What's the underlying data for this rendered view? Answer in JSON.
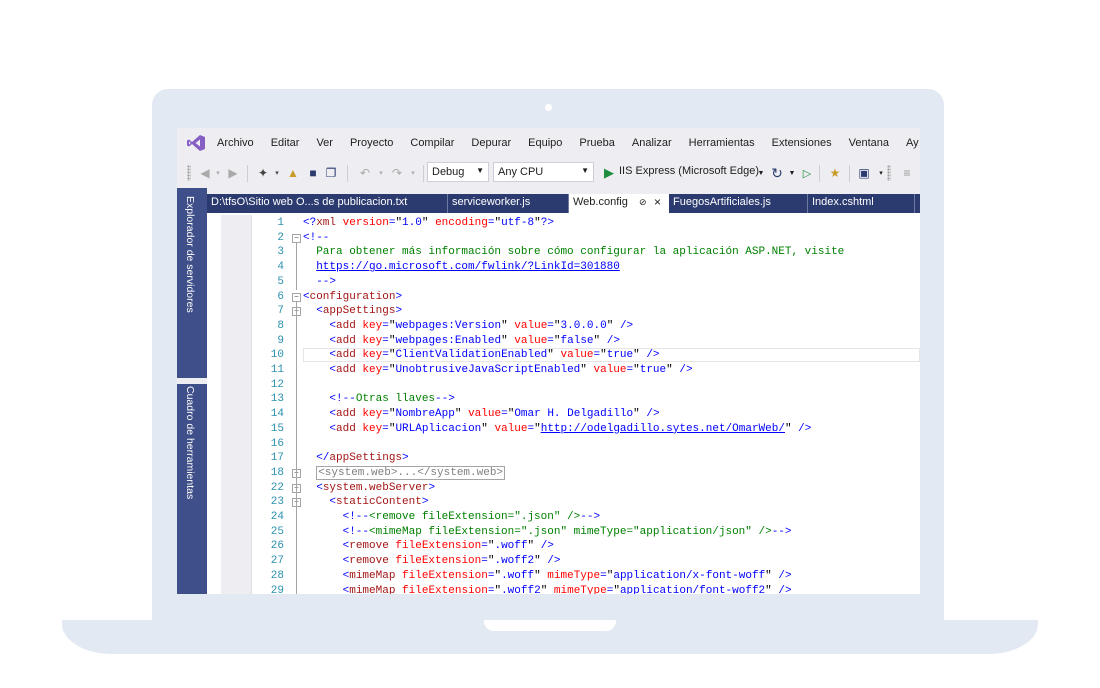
{
  "menu": {
    "items": [
      "Archivo",
      "Editar",
      "Ver",
      "Proyecto",
      "Compilar",
      "Depurar",
      "Equipo",
      "Prueba",
      "Analizar",
      "Herramientas",
      "Extensiones",
      "Ventana",
      "Ay"
    ]
  },
  "toolbar": {
    "config_value": "Debug",
    "platform_value": "Any CPU",
    "run_label": "IIS Express (Microsoft Edge)"
  },
  "rail": {
    "server_explorer": "Explorador de servidores",
    "toolbox": "Cuadro de herramientas"
  },
  "tabs": [
    {
      "label": "D:\\tfsO\\Sitio web O...s de publicacion.txt"
    },
    {
      "label": "serviceworker.js"
    },
    {
      "label": "Web.config"
    },
    {
      "label": "FuegosArtificiales.js"
    },
    {
      "label": "Index.cshtml"
    }
  ],
  "colors": {
    "rail_bg": "#3f4f89",
    "tab_strip": "#2b3b70",
    "vs_purple": "#865fc5",
    "play_green": "#1e8c3c",
    "keyword_blue": "#0000ff",
    "element_maroon": "#a31515",
    "attribute_red": "#ff0000",
    "comment_green": "#008000",
    "line_number": "#2b91af"
  },
  "editor": {
    "lines": [
      {
        "n": "1",
        "fold": "",
        "segs": [
          [
            "t-blue",
            "<?"
          ],
          [
            "t-maroon",
            "xml"
          ],
          [
            "t-red",
            " version"
          ],
          [
            "t-blue",
            "="
          ],
          [
            "t-black",
            "\""
          ],
          [
            "t-blue",
            "1.0"
          ],
          [
            "t-black",
            "\""
          ],
          [
            "t-red",
            " encoding"
          ],
          [
            "t-blue",
            "="
          ],
          [
            "t-black",
            "\""
          ],
          [
            "t-blue",
            "utf-8"
          ],
          [
            "t-black",
            "\""
          ],
          [
            "t-blue",
            "?>"
          ]
        ]
      },
      {
        "n": "2",
        "fold": "minus",
        "segs": [
          [
            "t-blue",
            "<!--"
          ]
        ]
      },
      {
        "n": "3",
        "fold": "",
        "segs": [
          [
            "t-green",
            "  Para obtener más información sobre cómo configurar la aplicación ASP.NET, visite"
          ]
        ]
      },
      {
        "n": "4",
        "fold": "",
        "segs": [
          [
            "t-green",
            "  "
          ],
          [
            "t-link",
            "https://go.microsoft.com/fwlink/?LinkId=301880"
          ]
        ]
      },
      {
        "n": "5",
        "fold": "",
        "segs": [
          [
            "t-blue",
            "  -->"
          ]
        ]
      },
      {
        "n": "6",
        "fold": "minus",
        "segs": [
          [
            "t-blue",
            "<"
          ],
          [
            "t-maroon",
            "configuration"
          ],
          [
            "t-blue",
            ">"
          ]
        ]
      },
      {
        "n": "7",
        "fold": "minus",
        "segs": [
          [
            "t-blue",
            "  <"
          ],
          [
            "t-maroon",
            "appSettings"
          ],
          [
            "t-blue",
            ">"
          ]
        ]
      },
      {
        "n": "8",
        "fold": "",
        "segs": [
          [
            "t-blue",
            "    <"
          ],
          [
            "t-maroon",
            "add"
          ],
          [
            "t-red",
            " key"
          ],
          [
            "t-blue",
            "="
          ],
          [
            "t-black",
            "\""
          ],
          [
            "t-blue",
            "webpages:Version"
          ],
          [
            "t-black",
            "\""
          ],
          [
            "t-red",
            " value"
          ],
          [
            "t-blue",
            "="
          ],
          [
            "t-black",
            "\""
          ],
          [
            "t-blue",
            "3.0.0.0"
          ],
          [
            "t-black",
            "\""
          ],
          [
            "t-blue",
            " />"
          ]
        ]
      },
      {
        "n": "9",
        "fold": "",
        "segs": [
          [
            "t-blue",
            "    <"
          ],
          [
            "t-maroon",
            "add"
          ],
          [
            "t-red",
            " key"
          ],
          [
            "t-blue",
            "="
          ],
          [
            "t-black",
            "\""
          ],
          [
            "t-blue",
            "webpages:Enabled"
          ],
          [
            "t-black",
            "\""
          ],
          [
            "t-red",
            " value"
          ],
          [
            "t-blue",
            "="
          ],
          [
            "t-black",
            "\""
          ],
          [
            "t-blue",
            "false"
          ],
          [
            "t-black",
            "\""
          ],
          [
            "t-blue",
            " />"
          ]
        ]
      },
      {
        "n": "10",
        "fold": "",
        "current": true,
        "segs": [
          [
            "t-blue",
            "    <"
          ],
          [
            "t-maroon",
            "add"
          ],
          [
            "t-red",
            " key"
          ],
          [
            "t-blue",
            "="
          ],
          [
            "t-black",
            "\""
          ],
          [
            "t-blue",
            "ClientValidationEnabled"
          ],
          [
            "t-black",
            "\""
          ],
          [
            "t-red",
            " value"
          ],
          [
            "t-blue",
            "="
          ],
          [
            "t-black",
            "\""
          ],
          [
            "t-blue",
            "true"
          ],
          [
            "t-black",
            "\""
          ],
          [
            "t-blue",
            " />"
          ]
        ]
      },
      {
        "n": "11",
        "fold": "",
        "segs": [
          [
            "t-blue",
            "    <"
          ],
          [
            "t-maroon",
            "add"
          ],
          [
            "t-red",
            " key"
          ],
          [
            "t-blue",
            "="
          ],
          [
            "t-black",
            "\""
          ],
          [
            "t-blue",
            "UnobtrusiveJavaScriptEnabled"
          ],
          [
            "t-black",
            "\""
          ],
          [
            "t-red",
            " value"
          ],
          [
            "t-blue",
            "="
          ],
          [
            "t-black",
            "\""
          ],
          [
            "t-blue",
            "true"
          ],
          [
            "t-black",
            "\""
          ],
          [
            "t-blue",
            " />"
          ]
        ]
      },
      {
        "n": "12",
        "fold": "",
        "segs": []
      },
      {
        "n": "13",
        "fold": "",
        "segs": [
          [
            "t-blue",
            "    <!--"
          ],
          [
            "t-green",
            "Otras llaves"
          ],
          [
            "t-blue",
            "-->"
          ]
        ]
      },
      {
        "n": "14",
        "fold": "",
        "segs": [
          [
            "t-blue",
            "    <"
          ],
          [
            "t-maroon",
            "add"
          ],
          [
            "t-red",
            " key"
          ],
          [
            "t-blue",
            "="
          ],
          [
            "t-black",
            "\""
          ],
          [
            "t-blue",
            "NombreApp"
          ],
          [
            "t-black",
            "\""
          ],
          [
            "t-red",
            " value"
          ],
          [
            "t-blue",
            "="
          ],
          [
            "t-black",
            "\""
          ],
          [
            "t-blue",
            "Omar H. Delgadillo"
          ],
          [
            "t-black",
            "\""
          ],
          [
            "t-blue",
            " />"
          ]
        ]
      },
      {
        "n": "15",
        "fold": "",
        "segs": [
          [
            "t-blue",
            "    <"
          ],
          [
            "t-maroon",
            "add"
          ],
          [
            "t-red",
            " key"
          ],
          [
            "t-blue",
            "="
          ],
          [
            "t-black",
            "\""
          ],
          [
            "t-blue",
            "URLAplicacion"
          ],
          [
            "t-black",
            "\""
          ],
          [
            "t-red",
            " value"
          ],
          [
            "t-blue",
            "="
          ],
          [
            "t-black",
            "\""
          ],
          [
            "t-link",
            "http://odelgadillo.sytes.net/OmarWeb/"
          ],
          [
            "t-black",
            "\""
          ],
          [
            "t-blue",
            " />"
          ]
        ]
      },
      {
        "n": "16",
        "fold": "",
        "segs": []
      },
      {
        "n": "17",
        "fold": "",
        "segs": [
          [
            "t-blue",
            "  </"
          ],
          [
            "t-maroon",
            "appSettings"
          ],
          [
            "t-blue",
            ">"
          ]
        ]
      },
      {
        "n": "18",
        "fold": "plus",
        "segs": [
          [
            "t-blue",
            "  "
          ],
          [
            "collapsed",
            "<system.web>...</system.web>"
          ]
        ]
      },
      {
        "n": "22",
        "fold": "minus",
        "segs": [
          [
            "t-blue",
            "  <"
          ],
          [
            "t-maroon",
            "system.webServer"
          ],
          [
            "t-blue",
            ">"
          ]
        ]
      },
      {
        "n": "23",
        "fold": "minus",
        "segs": [
          [
            "t-blue",
            "    <"
          ],
          [
            "t-maroon",
            "staticContent"
          ],
          [
            "t-blue",
            ">"
          ]
        ]
      },
      {
        "n": "24",
        "fold": "",
        "segs": [
          [
            "t-blue",
            "      <!--"
          ],
          [
            "t-green",
            "<remove fileExtension=\".json\" />"
          ],
          [
            "t-blue",
            "-->"
          ]
        ]
      },
      {
        "n": "25",
        "fold": "",
        "segs": [
          [
            "t-blue",
            "      <!--"
          ],
          [
            "t-green",
            "<mimeMap fileExtension=\".json\" mimeType=\"application/json\" />"
          ],
          [
            "t-blue",
            "-->"
          ]
        ]
      },
      {
        "n": "26",
        "fold": "",
        "segs": [
          [
            "t-blue",
            "      <"
          ],
          [
            "t-maroon",
            "remove"
          ],
          [
            "t-red",
            " fileExtension"
          ],
          [
            "t-blue",
            "="
          ],
          [
            "t-black",
            "\""
          ],
          [
            "t-blue",
            ".woff"
          ],
          [
            "t-black",
            "\""
          ],
          [
            "t-blue",
            " />"
          ]
        ]
      },
      {
        "n": "27",
        "fold": "",
        "segs": [
          [
            "t-blue",
            "      <"
          ],
          [
            "t-maroon",
            "remove"
          ],
          [
            "t-red",
            " fileExtension"
          ],
          [
            "t-blue",
            "="
          ],
          [
            "t-black",
            "\""
          ],
          [
            "t-blue",
            ".woff2"
          ],
          [
            "t-black",
            "\""
          ],
          [
            "t-blue",
            " />"
          ]
        ]
      },
      {
        "n": "28",
        "fold": "",
        "segs": [
          [
            "t-blue",
            "      <"
          ],
          [
            "t-maroon",
            "mimeMap"
          ],
          [
            "t-red",
            " fileExtension"
          ],
          [
            "t-blue",
            "="
          ],
          [
            "t-black",
            "\""
          ],
          [
            "t-blue",
            ".woff"
          ],
          [
            "t-black",
            "\""
          ],
          [
            "t-red",
            " mimeType"
          ],
          [
            "t-blue",
            "="
          ],
          [
            "t-black",
            "\""
          ],
          [
            "t-blue",
            "application/x-font-woff"
          ],
          [
            "t-black",
            "\""
          ],
          [
            "t-blue",
            " />"
          ]
        ]
      },
      {
        "n": "29",
        "fold": "",
        "segs": [
          [
            "t-blue",
            "      <"
          ],
          [
            "t-maroon",
            "mimeMap"
          ],
          [
            "t-red",
            " fileExtension"
          ],
          [
            "t-blue",
            "="
          ],
          [
            "t-black",
            "\""
          ],
          [
            "t-blue",
            ".woff2"
          ],
          [
            "t-black",
            "\""
          ],
          [
            "t-red",
            " mimeType"
          ],
          [
            "t-blue",
            "="
          ],
          [
            "t-black",
            "\""
          ],
          [
            "t-blue",
            "application/font-woff2"
          ],
          [
            "t-black",
            "\""
          ],
          [
            "t-blue",
            " />"
          ]
        ]
      }
    ]
  }
}
